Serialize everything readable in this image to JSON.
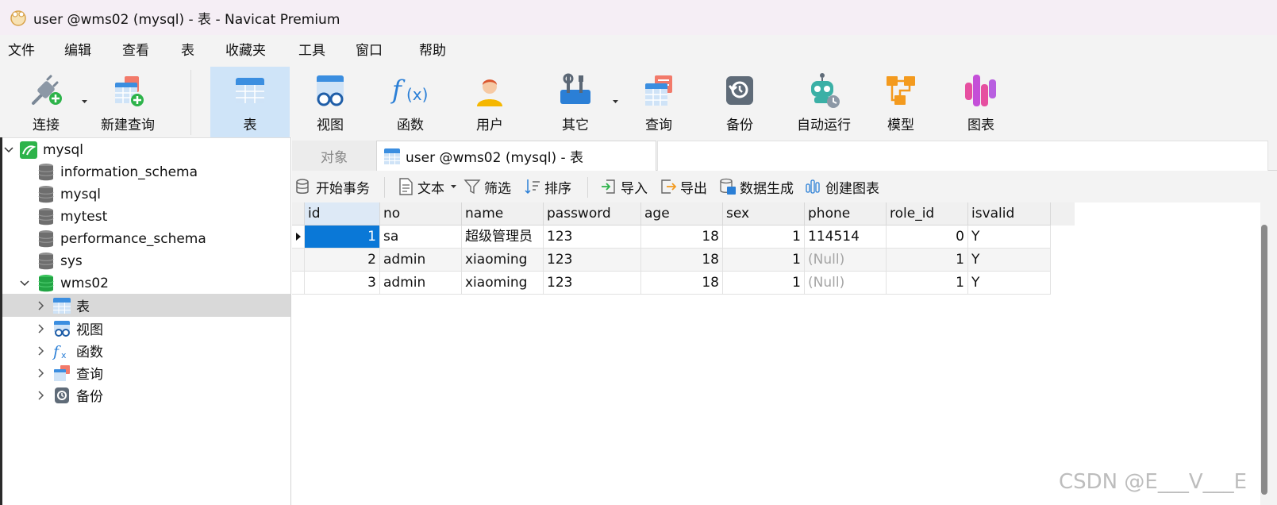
{
  "window": {
    "title": "user @wms02 (mysql) - 表 - Navicat Premium"
  },
  "menu": [
    "文件",
    "编辑",
    "查看",
    "表",
    "收藏夹",
    "工具",
    "窗口",
    "帮助"
  ],
  "toolbar": {
    "connect": "连接",
    "new_query": "新建查询",
    "table": "表",
    "view": "视图",
    "function": "函数",
    "user": "用户",
    "other": "其它",
    "query": "查询",
    "backup": "备份",
    "auto_run": "自动运行",
    "model": "模型",
    "chart": "图表"
  },
  "sidebar": {
    "connection": "mysql",
    "databases": [
      "information_schema",
      "mysql",
      "mytest",
      "performance_schema",
      "sys"
    ],
    "open_db": "wms02",
    "db_children": [
      "表",
      "视图",
      "函数",
      "查询",
      "备份"
    ]
  },
  "tabs": {
    "objects": "对象",
    "current": "user @wms02 (mysql) - 表"
  },
  "subtoolbar": {
    "begin_transaction": "开始事务",
    "text": "文本",
    "filter": "筛选",
    "sort": "排序",
    "import": "导入",
    "export": "导出",
    "generate_data": "数据生成",
    "create_chart": "创建图表"
  },
  "grid": {
    "columns": [
      "id",
      "no",
      "name",
      "password",
      "age",
      "sex",
      "phone",
      "role_id",
      "isvalid"
    ],
    "rows": [
      [
        "1",
        "sa",
        "超级管理员",
        "123",
        "18",
        "1",
        "114514",
        "0",
        "Y"
      ],
      [
        "2",
        "admin",
        "xiaoming",
        "123",
        "18",
        "1",
        "(Null)",
        "1",
        "Y"
      ],
      [
        "3",
        "admin",
        "xiaoming",
        "123",
        "18",
        "1",
        "(Null)",
        "1",
        "Y"
      ]
    ]
  },
  "watermark": "CSDN @E___V___E",
  "colors": {
    "accent": "#0a78d7",
    "toolbar_bg": "#f3f3f3",
    "active_tool": "#cfe4f8",
    "null_text": "#a5a5a5"
  }
}
